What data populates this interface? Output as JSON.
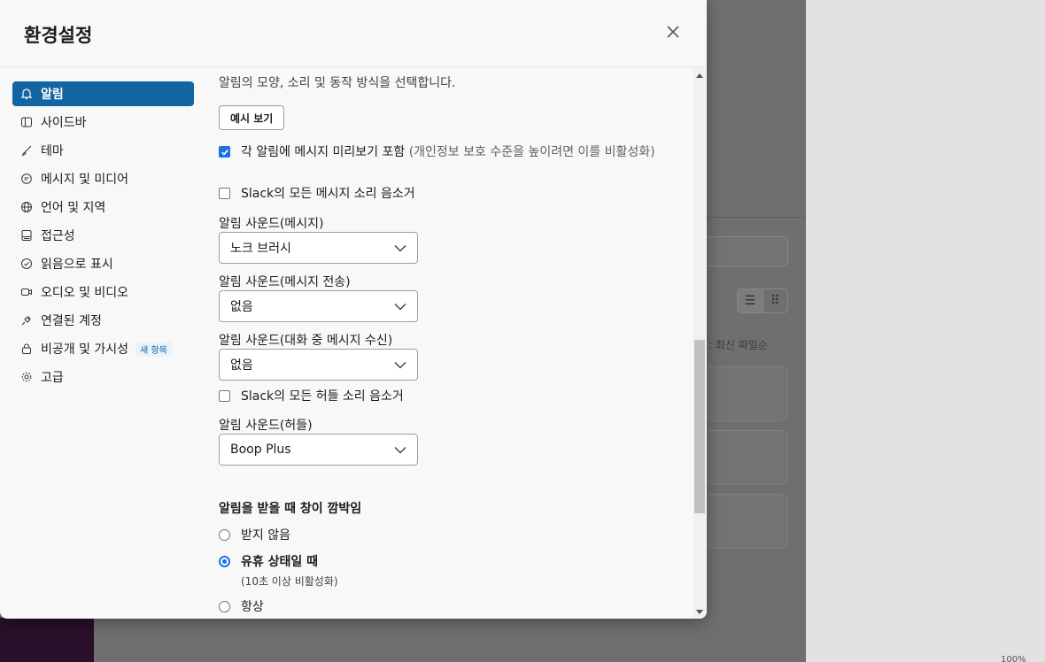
{
  "modal": {
    "title": "환경설정"
  },
  "sidebar": {
    "items": [
      {
        "label": "알림",
        "icon": "bell-icon",
        "active": true
      },
      {
        "label": "사이드바",
        "icon": "sidebar-icon"
      },
      {
        "label": "테마",
        "icon": "brush-icon"
      },
      {
        "label": "메시지 및 미디어",
        "icon": "message-icon"
      },
      {
        "label": "언어 및 지역",
        "icon": "globe-icon"
      },
      {
        "label": "접근성",
        "icon": "accessibility-icon"
      },
      {
        "label": "읽음으로 표시",
        "icon": "check-circle-icon"
      },
      {
        "label": "오디오 및 비디오",
        "icon": "video-icon"
      },
      {
        "label": "연결된 계정",
        "icon": "plug-icon"
      },
      {
        "label": "비공개 및 가시성",
        "icon": "lock-icon",
        "badge": "새 항목"
      },
      {
        "label": "고급",
        "icon": "gear-icon"
      }
    ]
  },
  "content": {
    "intro": "알림의 모양, 소리 및 동작 방식을 선택합니다.",
    "preview_button": "예시 보기",
    "include_preview": {
      "label": "각 알림에 메시지 미리보기 포함",
      "note": "(개인정보 보호 수준을 높이려면 이를 비활성화)",
      "checked": true
    },
    "mute_messages": {
      "label": "Slack의 모든 메시지 소리 음소거",
      "checked": false
    },
    "sound_message": {
      "label": "알림 사운드(메시지)",
      "value": "노크 브러시"
    },
    "sound_message_sent": {
      "label": "알림 사운드(메시지 전송)",
      "value": "없음"
    },
    "sound_in_conversation": {
      "label": "알림 사운드(대화 중 메시지 수신)",
      "value": "없음"
    },
    "mute_huddles": {
      "label": "Slack의 모든 허들 소리 음소거",
      "checked": false
    },
    "sound_huddle": {
      "label": "알림 사운드(허들)",
      "value": "Boop Plus"
    },
    "flash": {
      "title": "알림을 받을 때 창이 깜박임",
      "options": [
        {
          "label": "받지 않음",
          "checked": false
        },
        {
          "label": "유휴 상태일 때",
          "sub": "(10초 이상 비활성화)",
          "checked": true
        },
        {
          "label": "항상",
          "checked": false
        }
      ]
    }
  },
  "background": {
    "sort_label": ": 최신 파일순",
    "status": "100%"
  },
  "colors": {
    "accent": "#1264a3",
    "checkbox": "#1a73e8"
  }
}
